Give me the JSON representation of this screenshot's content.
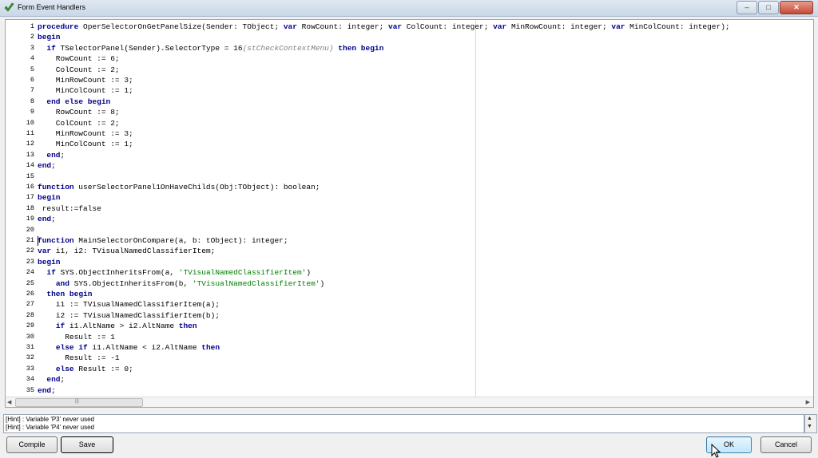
{
  "window": {
    "title": "Form Event Handlers",
    "buttons": {
      "minimize": "–",
      "maximize": "□",
      "close": "✕"
    }
  },
  "editor": {
    "lines": [
      {
        "n": "1",
        "segs": [
          {
            "t": "procedure",
            "c": "kw"
          },
          {
            "t": " OperSelectorOnGetPanelSize(Sender: TObject; "
          },
          {
            "t": "var",
            "c": "kw"
          },
          {
            "t": " RowCount: integer; "
          },
          {
            "t": "var",
            "c": "kw"
          },
          {
            "t": " ColCount: integer; "
          },
          {
            "t": "var",
            "c": "kw"
          },
          {
            "t": " MinRowCount: integer; "
          },
          {
            "t": "var",
            "c": "kw"
          },
          {
            "t": " MinColCount: integer);"
          }
        ]
      },
      {
        "n": "2",
        "segs": [
          {
            "t": "begin",
            "c": "kw"
          }
        ]
      },
      {
        "n": "3",
        "segs": [
          {
            "t": "  "
          },
          {
            "t": "if",
            "c": "kw"
          },
          {
            "t": " TSelectorPanel(Sender).SelectorType = 16"
          },
          {
            "t": "(stCheckContextMenu)",
            "c": "cmt"
          },
          {
            "t": " "
          },
          {
            "t": "then begin",
            "c": "kw"
          }
        ]
      },
      {
        "n": "4",
        "segs": [
          {
            "t": "    RowCount := 6;"
          }
        ]
      },
      {
        "n": "5",
        "segs": [
          {
            "t": "    ColCount := 2;"
          }
        ]
      },
      {
        "n": "6",
        "segs": [
          {
            "t": "    MinRowCount := 3;"
          }
        ]
      },
      {
        "n": "7",
        "segs": [
          {
            "t": "    MinColCount := 1;"
          }
        ]
      },
      {
        "n": "8",
        "segs": [
          {
            "t": "  "
          },
          {
            "t": "end else begin",
            "c": "kw"
          }
        ]
      },
      {
        "n": "9",
        "segs": [
          {
            "t": "    RowCount := 8;"
          }
        ]
      },
      {
        "n": "10",
        "segs": [
          {
            "t": "    ColCount := 2;"
          }
        ]
      },
      {
        "n": "11",
        "segs": [
          {
            "t": "    MinRowCount := 3;"
          }
        ]
      },
      {
        "n": "12",
        "segs": [
          {
            "t": "    MinColCount := 1;"
          }
        ]
      },
      {
        "n": "13",
        "segs": [
          {
            "t": "  "
          },
          {
            "t": "end",
            "c": "kw"
          },
          {
            "t": ";"
          }
        ]
      },
      {
        "n": "14",
        "segs": [
          {
            "t": "end",
            "c": "kw"
          },
          {
            "t": ";"
          }
        ]
      },
      {
        "n": "15",
        "segs": []
      },
      {
        "n": "16",
        "segs": [
          {
            "t": "function",
            "c": "kw"
          },
          {
            "t": " userSelectorPanel1OnHaveChilds(Obj:TObject): boolean;"
          }
        ]
      },
      {
        "n": "17",
        "segs": [
          {
            "t": "begin",
            "c": "kw"
          }
        ]
      },
      {
        "n": "18",
        "segs": [
          {
            "t": " result:=false"
          }
        ]
      },
      {
        "n": "19",
        "segs": [
          {
            "t": "end",
            "c": "kw"
          },
          {
            "t": ";"
          }
        ]
      },
      {
        "n": "20",
        "segs": []
      },
      {
        "n": "21",
        "segs": [
          {
            "t": "function",
            "c": "kw"
          },
          {
            "t": " MainSelectorOnCompare(a, b: tObject): integer;"
          }
        ]
      },
      {
        "n": "22",
        "segs": [
          {
            "t": "var",
            "c": "kw"
          },
          {
            "t": " i1, i2: TVisualNamedClassifierItem;"
          }
        ]
      },
      {
        "n": "23",
        "segs": [
          {
            "t": "begin",
            "c": "kw"
          }
        ]
      },
      {
        "n": "24",
        "segs": [
          {
            "t": "  "
          },
          {
            "t": "if",
            "c": "kw"
          },
          {
            "t": " SYS.ObjectInheritsFrom(a, "
          },
          {
            "t": "'TVisualNamedClassifierItem'",
            "c": "str"
          },
          {
            "t": ")"
          }
        ]
      },
      {
        "n": "25",
        "segs": [
          {
            "t": "    "
          },
          {
            "t": "and",
            "c": "kw"
          },
          {
            "t": " SYS.ObjectInheritsFrom(b, "
          },
          {
            "t": "'TVisualNamedClassifierItem'",
            "c": "str"
          },
          {
            "t": ")"
          }
        ]
      },
      {
        "n": "26",
        "segs": [
          {
            "t": "  "
          },
          {
            "t": "then begin",
            "c": "kw"
          }
        ]
      },
      {
        "n": "27",
        "segs": [
          {
            "t": "    i1 := TVisualNamedClassifierItem(a);"
          }
        ]
      },
      {
        "n": "28",
        "segs": [
          {
            "t": "    i2 := TVisualNamedClassifierItem(b);"
          }
        ]
      },
      {
        "n": "29",
        "segs": [
          {
            "t": "    "
          },
          {
            "t": "if",
            "c": "kw"
          },
          {
            "t": " i1.AltName > i2.AltName "
          },
          {
            "t": "then",
            "c": "kw"
          }
        ]
      },
      {
        "n": "30",
        "segs": [
          {
            "t": "      Result := 1"
          }
        ]
      },
      {
        "n": "31",
        "segs": [
          {
            "t": "    "
          },
          {
            "t": "else if",
            "c": "kw"
          },
          {
            "t": " i1.AltName < i2.AltName "
          },
          {
            "t": "then",
            "c": "kw"
          }
        ]
      },
      {
        "n": "32",
        "segs": [
          {
            "t": "      Result := -1"
          }
        ]
      },
      {
        "n": "33",
        "segs": [
          {
            "t": "    "
          },
          {
            "t": "else",
            "c": "kw"
          },
          {
            "t": " Result := 0;"
          }
        ]
      },
      {
        "n": "34",
        "segs": [
          {
            "t": "  "
          },
          {
            "t": "end",
            "c": "kw"
          },
          {
            "t": ";"
          }
        ]
      },
      {
        "n": "35",
        "segs": [
          {
            "t": "end",
            "c": "kw"
          },
          {
            "t": ";"
          }
        ]
      }
    ],
    "scrollbar_grip": "|||"
  },
  "hints": [
    "[Hint] : Variable 'P3' never used",
    "[Hint] : Variable 'P4' never used"
  ],
  "buttons": {
    "compile": "Compile",
    "save": "Save",
    "ok": "OK",
    "cancel": "Cancel"
  }
}
